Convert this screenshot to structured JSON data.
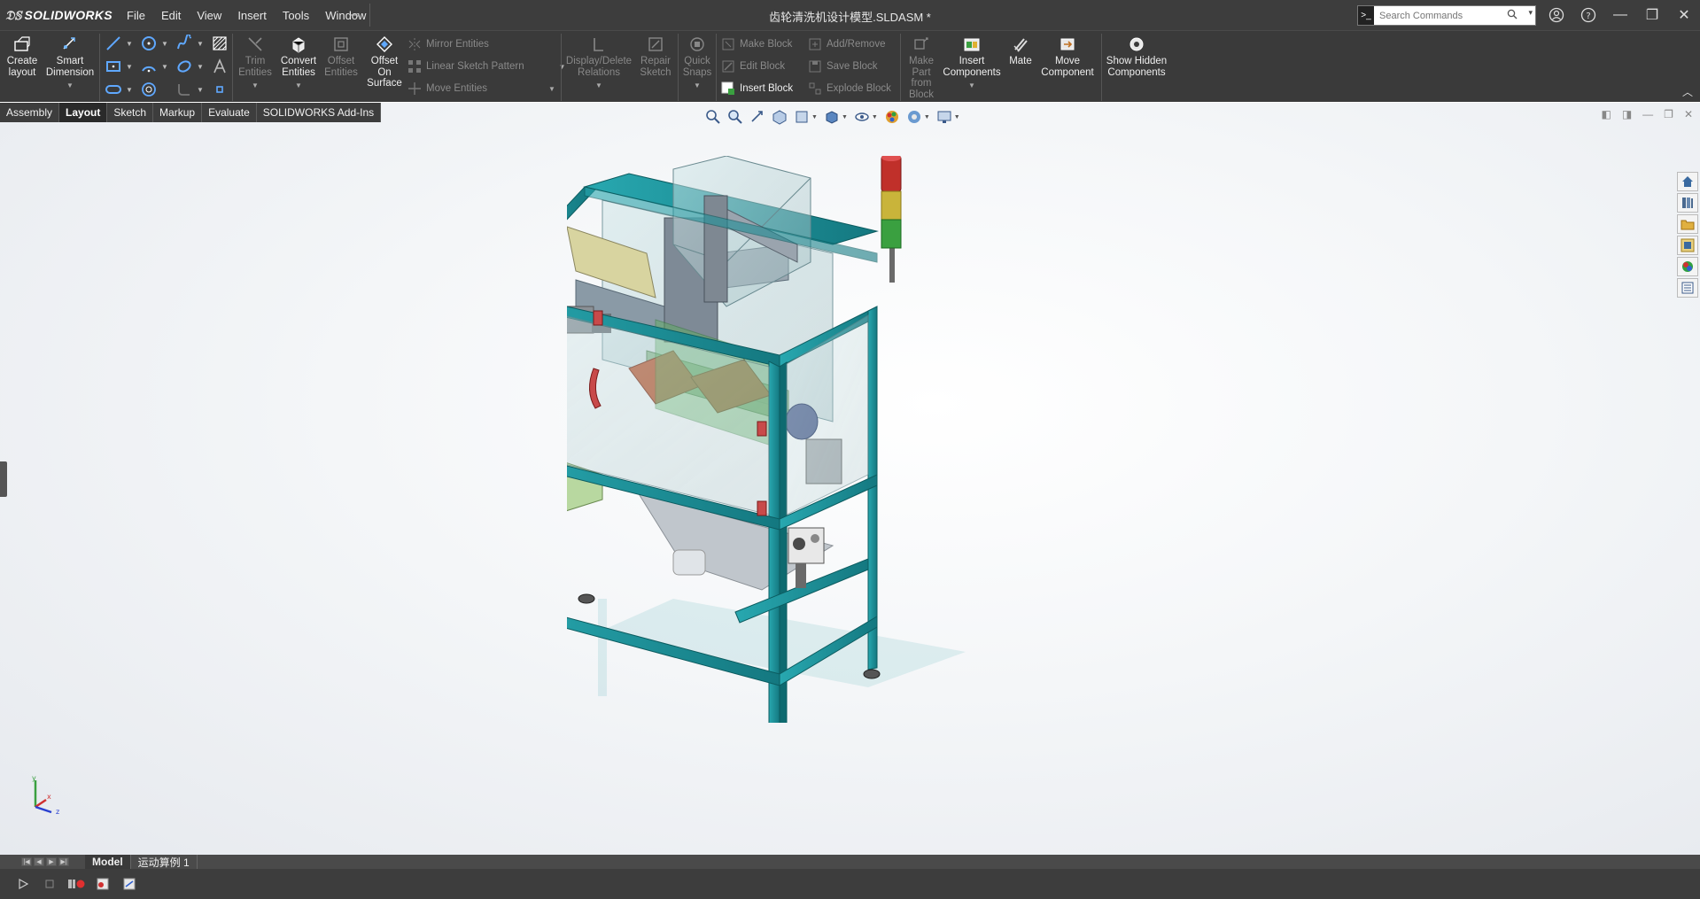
{
  "app": {
    "name": "SOLIDWORKS",
    "document_title": "齿轮清洗机设计模型.SLDASM *"
  },
  "menu": [
    "File",
    "Edit",
    "View",
    "Insert",
    "Tools",
    "Window"
  ],
  "search": {
    "placeholder": "Search Commands"
  },
  "ribbon": {
    "create_layout": "Create layout",
    "smart_dimension": "Smart Dimension",
    "trim_entities": "Trim Entities",
    "convert_entities": "Convert Entities",
    "offset_entities": "Offset Entities",
    "offset_on_surface": "Offset On Surface",
    "mirror_entities": "Mirror Entities",
    "linear_sketch_pattern": "Linear Sketch Pattern",
    "move_entities": "Move Entities",
    "display_delete_relations": "Display/Delete Relations",
    "repair_sketch": "Repair Sketch",
    "quick_snaps": "Quick Snaps",
    "make_block": "Make Block",
    "edit_block": "Edit Block",
    "insert_block": "Insert Block",
    "add_remove": "Add/Remove",
    "save_block": "Save Block",
    "explode_block": "Explode Block",
    "make_part_from_block": "Make Part from Block",
    "insert_components": "Insert Components",
    "mate": "Mate",
    "move_component": "Move Component",
    "show_hidden_components": "Show Hidden Components"
  },
  "tabs": [
    {
      "label": "Assembly",
      "active": false
    },
    {
      "label": "Layout",
      "active": true
    },
    {
      "label": "Sketch",
      "active": false
    },
    {
      "label": "Markup",
      "active": false
    },
    {
      "label": "Evaluate",
      "active": false
    },
    {
      "label": "SOLIDWORKS Add-Ins",
      "active": false
    }
  ],
  "bottom_tabs": [
    {
      "label": "Model",
      "active": true
    },
    {
      "label": "运动算例 1",
      "active": false
    }
  ],
  "triad": {
    "x": "x",
    "y": "y",
    "z": "z"
  },
  "colors": {
    "frame": "#1f9aa2",
    "beacon_red": "#c0302a",
    "beacon_yellow": "#c9b43a",
    "beacon_green": "#3aa040",
    "chrome_dark": "#3d3d3d"
  }
}
